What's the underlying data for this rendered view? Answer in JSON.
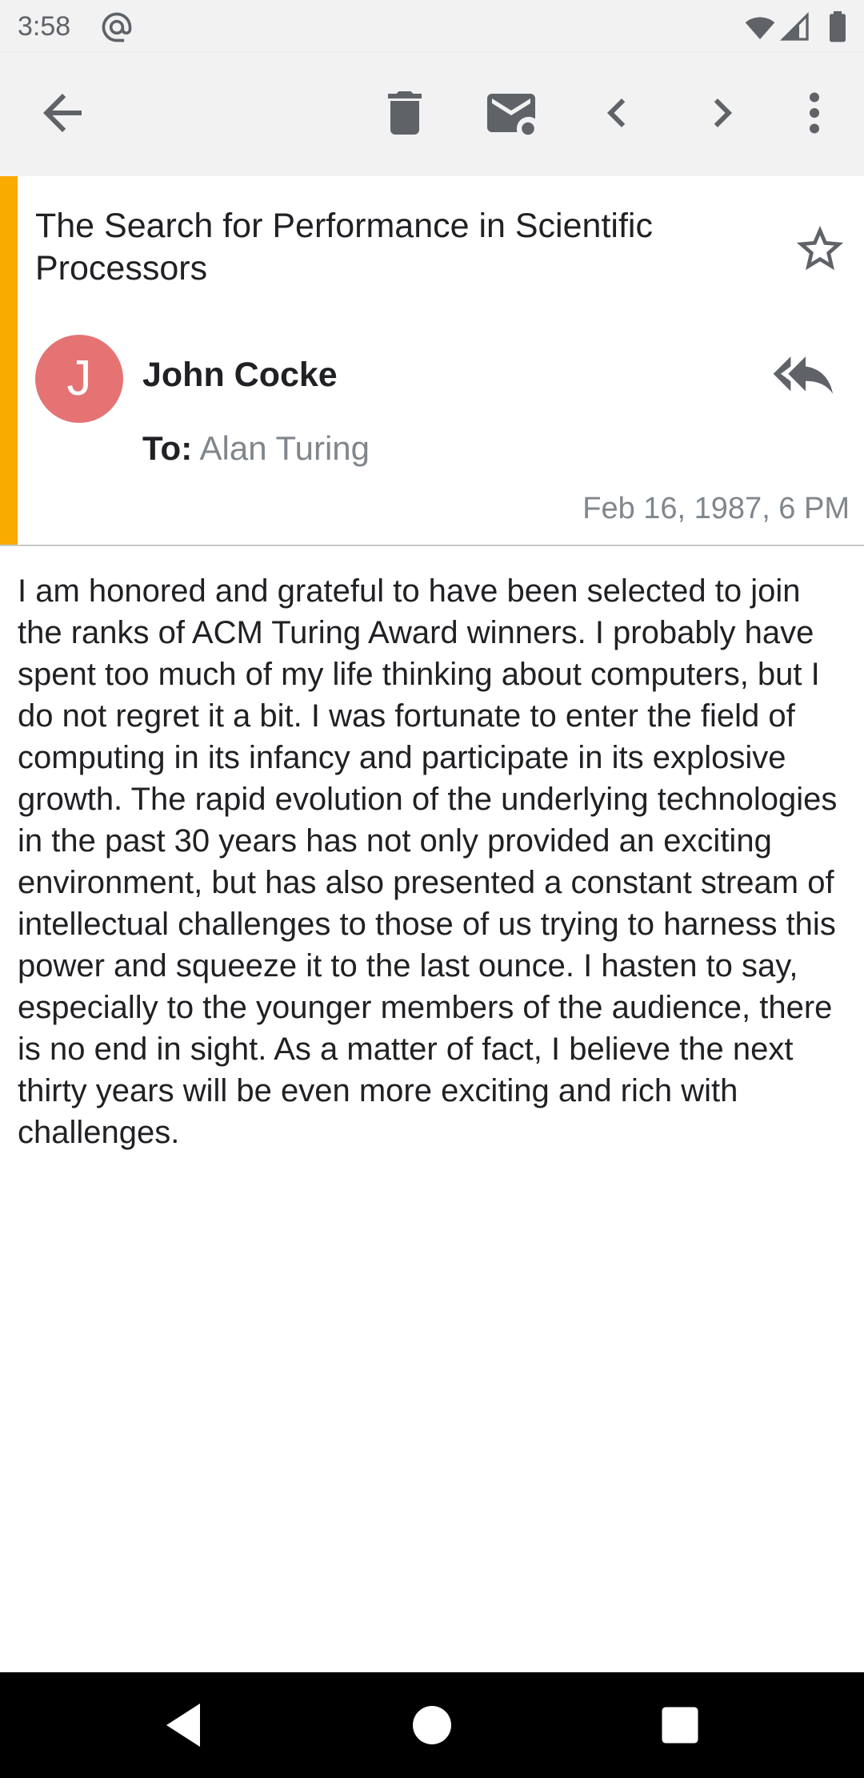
{
  "status_bar": {
    "time": "3:58",
    "icons": [
      "at-sign-icon",
      "wifi-icon",
      "signal-icon",
      "battery-icon"
    ]
  },
  "toolbar": {
    "buttons": [
      "back-arrow-icon",
      "delete-icon",
      "mark-unread-icon",
      "previous-icon",
      "next-icon",
      "more-options-icon"
    ]
  },
  "email": {
    "subject": "The Search for Performance in Scientific Processors",
    "sender_initial": "J",
    "sender_name": "John Cocke",
    "to_label": "To:",
    "to_value": "Alan Turing",
    "date": "Feb 16, 1987, 6 PM",
    "body": "I am honored and grateful to have been selected to join the ranks of ACM Turing Award winners. I probably have spent too much of my life thinking about computers, but I do not regret it a bit. I was fortunate to enter the field of computing in its infancy and participate in its explosive growth. The rapid evolution of the underlying technologies in the past 30 years has not only provided an exciting environment, but has also presented a constant stream of intellectual challenges to those of us trying to harness this power and squeeze it to the last ounce. I hasten to say, especially to the younger members of the audience, there is no end in sight. As a matter of fact, I believe the next thirty years will be even more exciting and rich with challenges."
  },
  "colors": {
    "accent": "#f9ab00",
    "avatar": "#e57373",
    "toolbar_bg": "#f2f2f2",
    "icon": "#5f6368"
  },
  "nav_bar": {
    "icons": [
      "nav-back-icon",
      "nav-home-icon",
      "nav-recents-icon"
    ]
  }
}
